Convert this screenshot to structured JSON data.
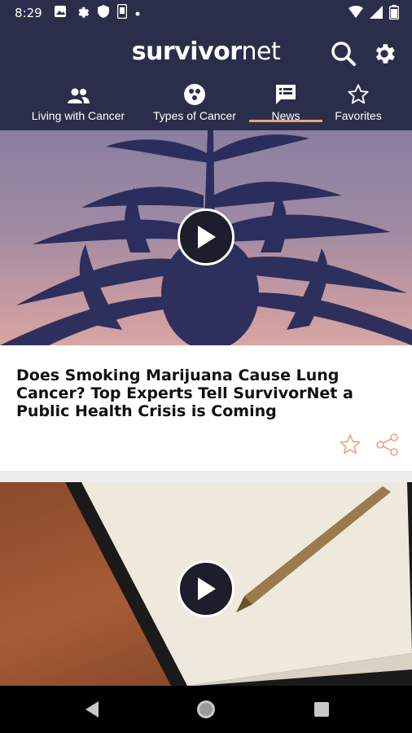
{
  "status_bar": {
    "time": "8:29",
    "left_icons": [
      "image-icon",
      "gear-icon",
      "shield-icon",
      "phone-icon",
      "dot-icon"
    ],
    "right_icons": [
      "wifi-icon",
      "signal-icon",
      "battery-icon"
    ]
  },
  "app_bar": {
    "logo_bold": "survivor",
    "logo_thin": "net",
    "search_icon": "search-icon",
    "settings_icon": "gear-icon"
  },
  "tabs": [
    {
      "label": "Living with Cancer",
      "icon": "people-icon",
      "selected": false
    },
    {
      "label": "Types of Cancer",
      "icon": "cells-icon",
      "selected": false
    },
    {
      "label": "News",
      "icon": "news-icon",
      "selected": true
    },
    {
      "label": "Favorites",
      "icon": "star-icon",
      "selected": false
    }
  ],
  "cards": [
    {
      "headline": "Does Smoking Marijuana Cause Lung Cancer? Top Experts Tell SurvivorNet a Public Health Crisis is Coming",
      "media": "video",
      "actions": [
        "favorite-star-icon",
        "share-icon"
      ]
    },
    {
      "headline": "",
      "media": "video"
    }
  ],
  "colors": {
    "primary": "#2b2e4a",
    "accent": "#f0a17c",
    "card_bg": "#ffffff",
    "divider": "#eeeeee"
  },
  "nav_bar": [
    "back-icon",
    "home-icon",
    "recents-icon"
  ]
}
